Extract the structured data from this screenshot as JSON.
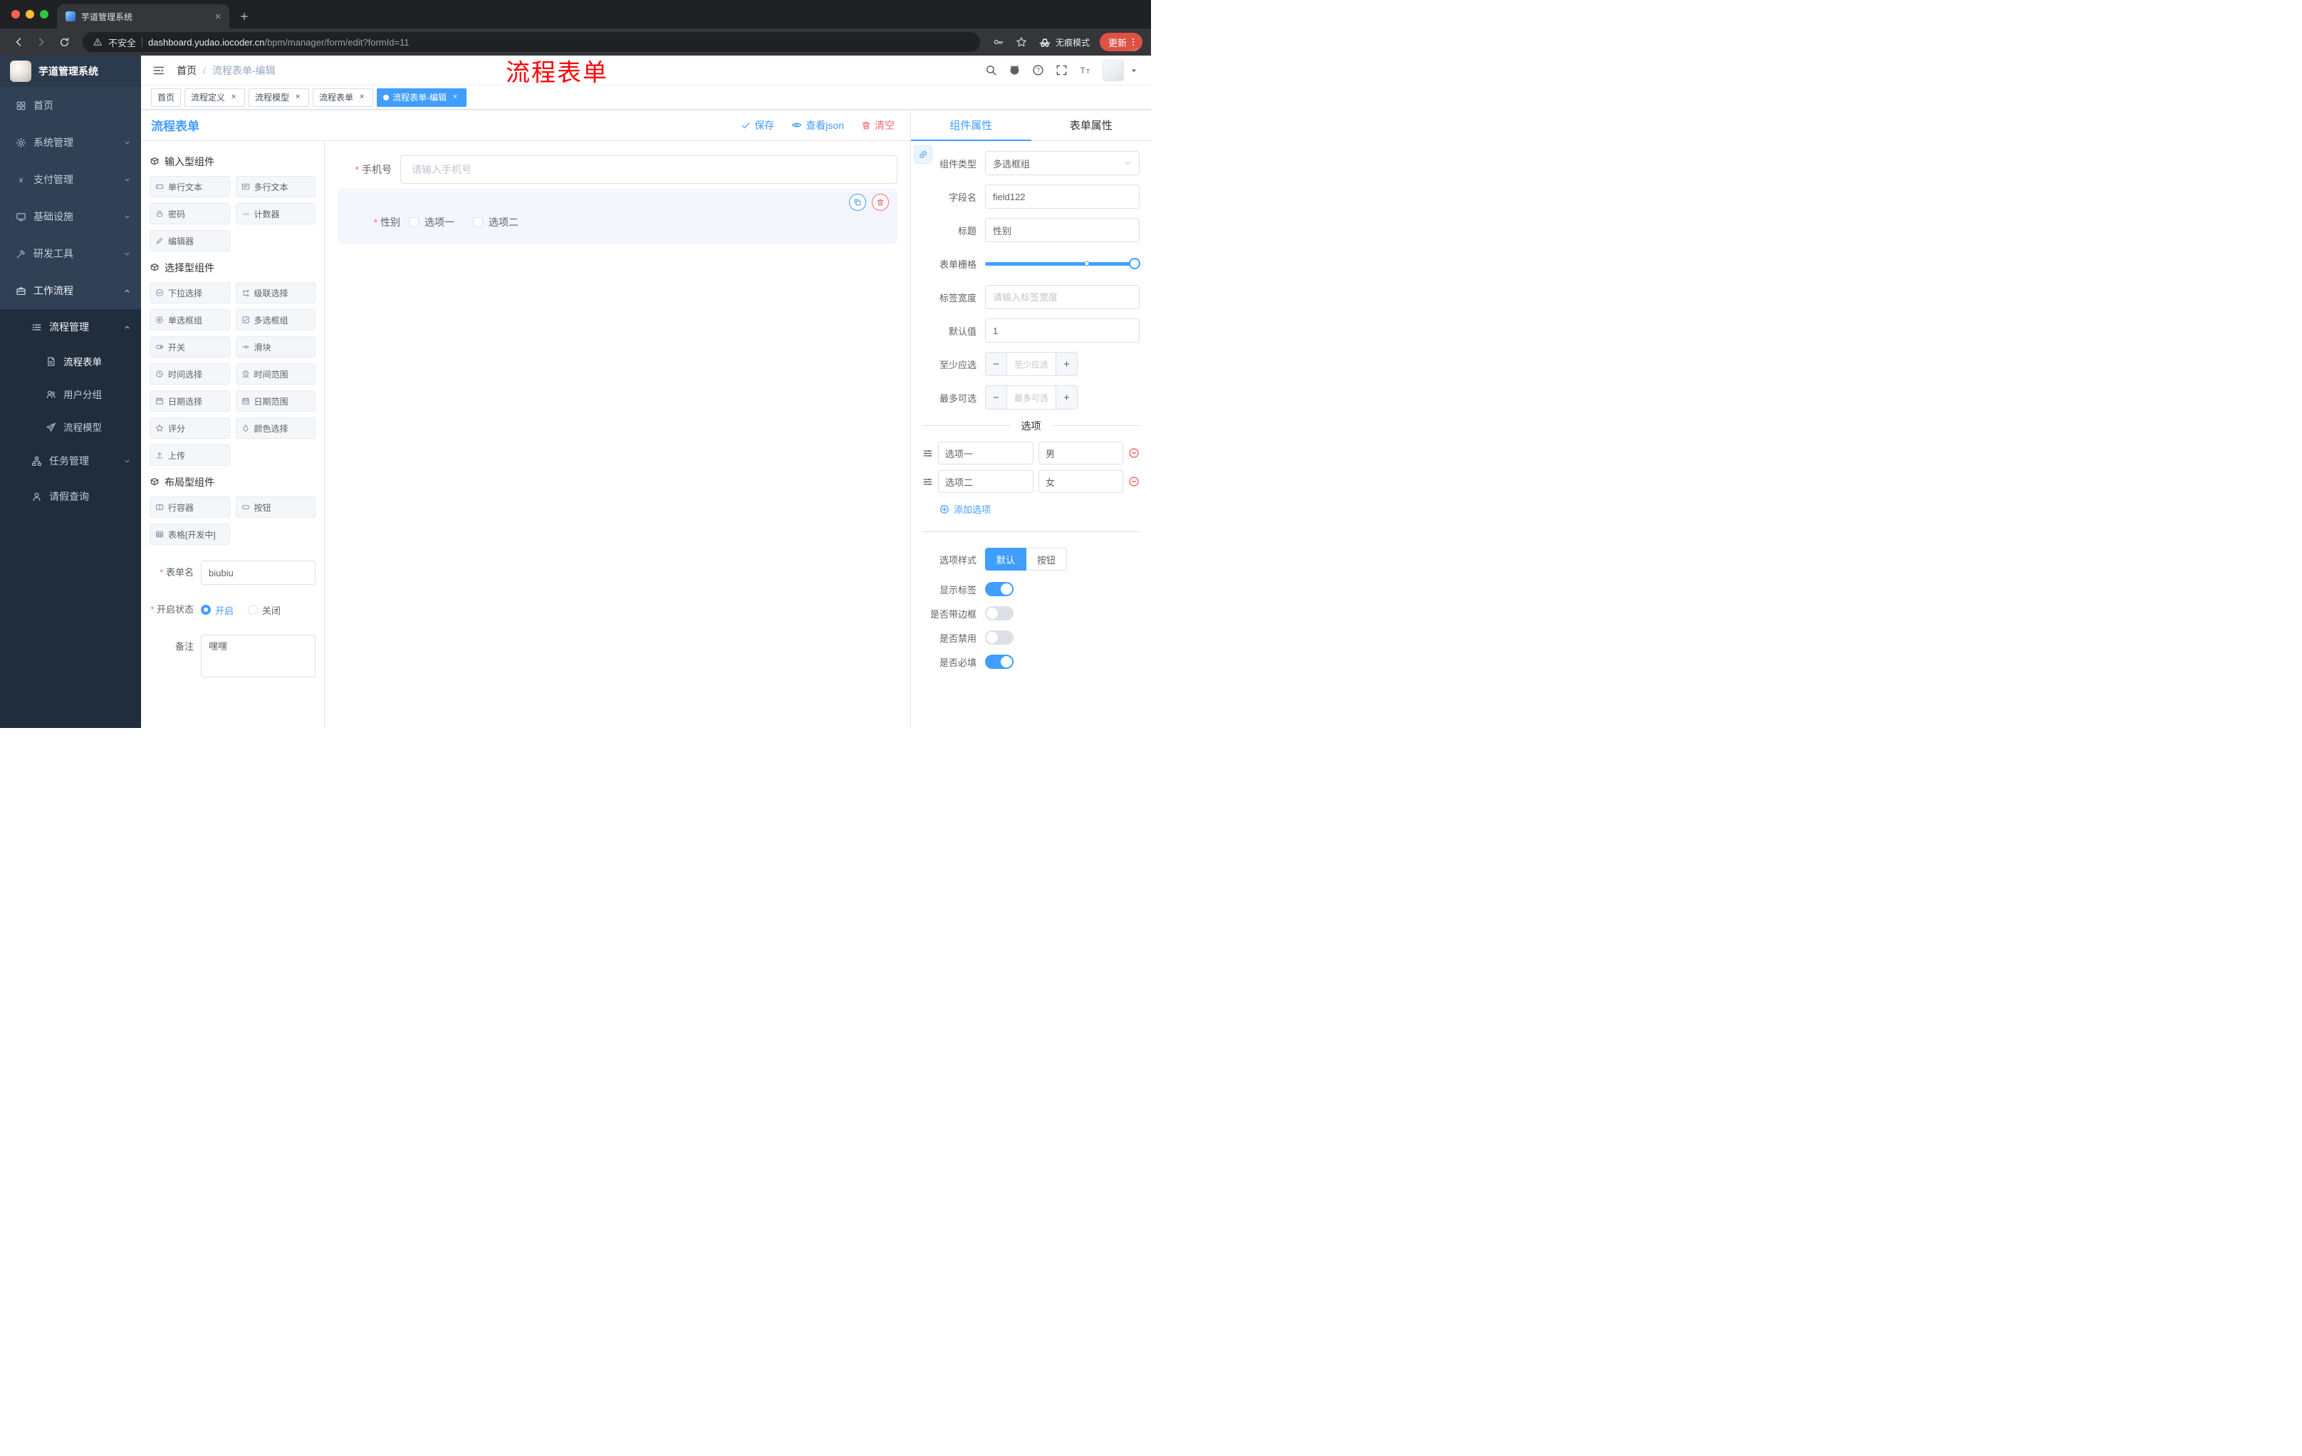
{
  "colors": {
    "primary": "#409EFF",
    "danger": "#F56C6C",
    "annotation_red": "#FF0000",
    "update_button_bg": "#DE5246",
    "sidebar_bg": "#304156",
    "sidebar_submenu_bg": "#1F2D3D",
    "active_tag_bg": "#409EFF"
  },
  "browser": {
    "tab_title": "芋道管理系统",
    "security_label": "不安全",
    "url_domain": "dashboard.yudao.iocoder.cn",
    "url_path": "/bpm/manager/form/edit?formId=11",
    "incognito_label": "无痕模式",
    "update_label": "更新"
  },
  "header": {
    "breadcrumb": [
      "首页",
      "流程表单-编辑"
    ],
    "annotation": "流程表单"
  },
  "tags_view": {
    "tabs": [
      {
        "key": "home",
        "label": "首页",
        "closable": false,
        "active": false
      },
      {
        "key": "process-definition",
        "label": "流程定义",
        "closable": true,
        "active": false
      },
      {
        "key": "process-model",
        "label": "流程模型",
        "closable": true,
        "active": false
      },
      {
        "key": "process-form",
        "label": "流程表单",
        "closable": true,
        "active": false
      },
      {
        "key": "process-form-edit",
        "label": "流程表单-编辑",
        "closable": true,
        "active": true
      }
    ]
  },
  "sidebar": {
    "logo_title": "芋道管理系统",
    "items": [
      {
        "key": "home",
        "label": "首页",
        "icon": "dashboard",
        "level": 0
      },
      {
        "key": "system-mgmt",
        "label": "系统管理",
        "icon": "gear",
        "level": 0,
        "chevron": "down"
      },
      {
        "key": "payment-mgmt",
        "label": "支付管理",
        "icon": "yen",
        "level": 0,
        "chevron": "down"
      },
      {
        "key": "infrastructure",
        "label": "基础设施",
        "icon": "monitor",
        "level": 0,
        "chevron": "down"
      },
      {
        "key": "dev-tools",
        "label": "研发工具",
        "icon": "tool",
        "level": 0,
        "chevron": "down"
      },
      {
        "key": "workflow",
        "label": "工作流程",
        "icon": "briefcase",
        "level": 0,
        "chevron": "up",
        "open": true
      },
      {
        "key": "process-mgmt",
        "label": "流程管理",
        "icon": "flow-list",
        "level": 1,
        "chevron": "up",
        "open": true,
        "dark": true
      },
      {
        "key": "process-form",
        "label": "流程表单",
        "icon": "document",
        "level": 2,
        "dark": true,
        "active": true
      },
      {
        "key": "user-group",
        "label": "用户分组",
        "icon": "user-group",
        "level": 2,
        "dark": true
      },
      {
        "key": "process-model",
        "label": "流程模型",
        "icon": "paper-plane",
        "level": 2,
        "dark": true
      },
      {
        "key": "task-mgmt",
        "label": "任务管理",
        "icon": "org-tree",
        "level": 1,
        "chevron": "down",
        "dark": true
      },
      {
        "key": "leave-query",
        "label": "请假查询",
        "icon": "person",
        "level": 1,
        "dark": true
      }
    ]
  },
  "designer": {
    "panel_title": "流程表单",
    "actions": {
      "save": "保存",
      "view_json": "查看json",
      "clear": "清空"
    },
    "component_groups": [
      {
        "title": "输入型组件",
        "items": [
          {
            "key": "single-line-text",
            "label": "单行文本",
            "icon": "input-field"
          },
          {
            "key": "multi-line-text",
            "label": "多行文本",
            "icon": "textarea"
          },
          {
            "key": "password",
            "label": "密码",
            "icon": "lock"
          },
          {
            "key": "counter",
            "label": "计数器",
            "icon": "counter"
          },
          {
            "key": "editor",
            "label": "编辑器",
            "icon": "editor"
          }
        ]
      },
      {
        "title": "选择型组件",
        "items": [
          {
            "key": "select",
            "label": "下拉选择",
            "icon": "select-circle"
          },
          {
            "key": "cascader",
            "label": "级联选择",
            "icon": "cascader"
          },
          {
            "key": "radio-group",
            "label": "单选框组",
            "icon": "radio"
          },
          {
            "key": "checkbox-group",
            "label": "多选框组",
            "icon": "checkbox"
          },
          {
            "key": "switch",
            "label": "开关",
            "icon": "switch"
          },
          {
            "key": "slider",
            "label": "滑块",
            "icon": "slider-control"
          },
          {
            "key": "time-picker",
            "label": "时间选择",
            "icon": "clock"
          },
          {
            "key": "time-range",
            "label": "时间范围",
            "icon": "clock-range"
          },
          {
            "key": "date-picker",
            "label": "日期选择",
            "icon": "calendar"
          },
          {
            "key": "date-range",
            "label": "日期范围",
            "icon": "calendar-range"
          },
          {
            "key": "rate",
            "label": "评分",
            "icon": "star"
          },
          {
            "key": "color-picker",
            "label": "颜色选择",
            "icon": "color-drop"
          },
          {
            "key": "upload",
            "label": "上传",
            "icon": "upload"
          }
        ]
      },
      {
        "title": "布局型组件",
        "items": [
          {
            "key": "row-container",
            "label": "行容器",
            "icon": "row-container"
          },
          {
            "key": "button",
            "label": "按钮",
            "icon": "button-widget"
          },
          {
            "key": "table-dev",
            "label": "表格[开发中]",
            "icon": "table"
          }
        ]
      }
    ],
    "form_meta": {
      "name_label": "表单名",
      "name_value": "biubiu",
      "status_label": "开启状态",
      "status_options": [
        "开启",
        "关闭"
      ],
      "status_selected": "开启",
      "remark_label": "备注",
      "remark_value": "嘿嘿"
    },
    "canvas": {
      "phone_label": "手机号",
      "phone_placeholder": "请输入手机号",
      "gender_label": "性别",
      "gender_options": [
        "选项一",
        "选项二"
      ]
    }
  },
  "properties": {
    "tabs": [
      {
        "key": "component",
        "label": "组件属性",
        "active": true
      },
      {
        "key": "form",
        "label": "表单属性",
        "active": false
      }
    ],
    "component_type": {
      "label": "组件类型",
      "value": "多选框组"
    },
    "field_name": {
      "label": "字段名",
      "value": "field122"
    },
    "title": {
      "label": "标题",
      "value": "性别"
    },
    "form_grid": {
      "label": "表单栅格",
      "value_percent": 100,
      "stop_percent": 66
    },
    "label_width": {
      "label": "标签宽度",
      "placeholder": "请输入标签宽度"
    },
    "default_value": {
      "label": "默认值",
      "value": "1"
    },
    "min_select": {
      "label": "至少应选",
      "placeholder": "至少应选"
    },
    "max_select": {
      "label": "最多可选",
      "placeholder": "最多可选"
    },
    "options_section": {
      "divider_title": "选项",
      "options": [
        {
          "label": "选项一",
          "value": "男"
        },
        {
          "label": "选项二",
          "value": "女"
        }
      ],
      "add_label": "添加选项"
    },
    "style_section": {
      "option_style": {
        "label": "选项样式",
        "values": [
          "默认",
          "按钮"
        ],
        "selected": "默认"
      },
      "toggles": [
        {
          "key": "show-label",
          "label": "显示标签",
          "on": true
        },
        {
          "key": "with-border",
          "label": "是否带边框",
          "on": false
        },
        {
          "key": "disabled",
          "label": "是否禁用",
          "on": false
        },
        {
          "key": "required",
          "label": "是否必填",
          "on": true
        }
      ]
    }
  }
}
